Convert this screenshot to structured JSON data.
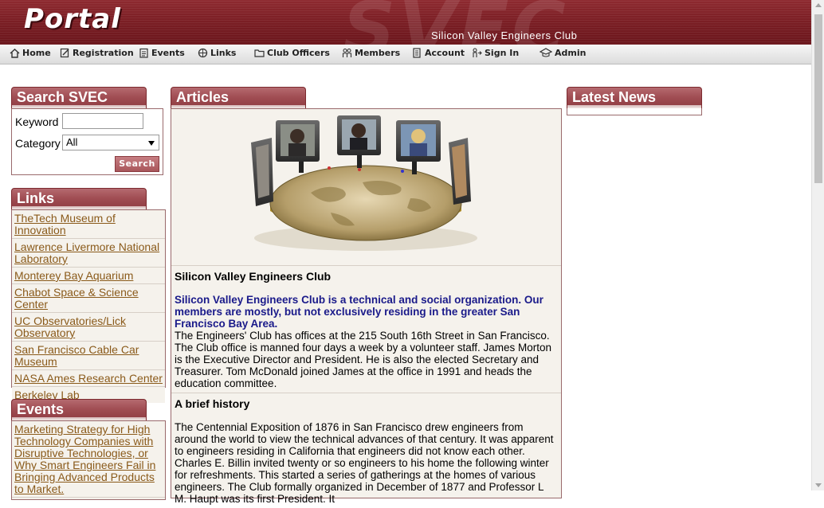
{
  "header": {
    "logo_text": "Portal",
    "watermark": "SVEC",
    "club_name": "Silicon Valley Engineers Club"
  },
  "nav": {
    "items": [
      {
        "label": "Home",
        "icon": "home-icon"
      },
      {
        "label": "Registration",
        "icon": "registration-icon"
      },
      {
        "label": "Events",
        "icon": "events-icon"
      },
      {
        "label": "Links",
        "icon": "links-icon"
      },
      {
        "label": "Club Officers",
        "icon": "folder-icon"
      },
      {
        "label": "Members",
        "icon": "members-icon"
      },
      {
        "label": "Account",
        "icon": "account-icon"
      },
      {
        "label": "Sign In",
        "icon": "sign-in-icon"
      },
      {
        "label": "Admin",
        "icon": "admin-icon"
      }
    ]
  },
  "search": {
    "title": "Search SVEC",
    "keyword_label": "Keyword",
    "keyword_value": "",
    "category_label": "Category",
    "category_value": "All",
    "button_label": "Search"
  },
  "links": {
    "title": "Links",
    "items": [
      "TheTech Museum of Innovation",
      "Lawrence Livermore National Laboratory",
      "Monterey Bay Aquarium",
      "Chabot Space & Science Center",
      "UC Observatories/Lick Observatory",
      "San Francisco Cable Car Museum",
      "NASA Ames Research Center",
      "Berkeley Lab"
    ]
  },
  "events": {
    "title": "Events",
    "items": [
      "Marketing Strategy for High Technology Companies with Disruptive Technologies, or Why Smart Engineers Fail in Bringing Advanced Products to Market."
    ]
  },
  "articles": {
    "title": "Articles",
    "section1_title": "Silicon Valley Engineers Club",
    "section1_intro": "Silicon Valley Engineers Club is a technical and social organization. Our members are mostly, but not exclusively residing in the greater San Francisco Bay Area.",
    "section1_body": "The Engineers' Club has offices at the 215 South 16th Street in San Francisco. The Club office is manned four days a week by a volunteer staff. James Morton is the Executive Director and President. He is also the elected Secretary and Treasurer. Tom McDonald joined James at the office in 1991 and heads the education committee.",
    "section2_title": "A brief history",
    "section2_body": "The Centennial Exposition of 1876 in San Francisco drew engineers from around the world to view the technical advances of that century. It was apparent to engineers residing in California that engineers did not know each other. Charles E. Billin invited twenty or so engineers to his home the following winter for refreshments. This started a series of gatherings at the homes of various engineers. The Club formally organized in December of 1877 and Professor L M. Haupt was its first President. It"
  },
  "news": {
    "title": "Latest News"
  }
}
